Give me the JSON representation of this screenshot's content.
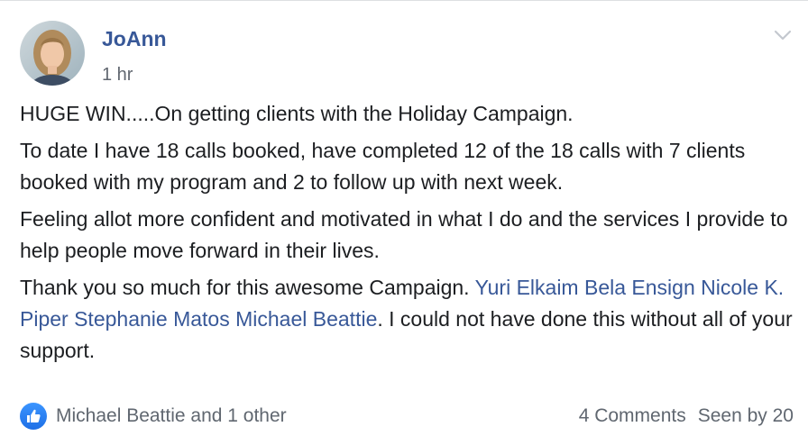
{
  "post": {
    "author": "JoAnn",
    "timestamp": "1 hr",
    "paragraphs": {
      "p1": "HUGE WIN.....On getting clients with the Holiday Campaign.",
      "p2": "To date I have 18 calls booked, have completed 12 of the 18 calls with 7 clients booked with my program and 2 to follow up with next week.",
      "p3": "Feeling allot more confident and motivated in what I do and the services I provide to help people move forward in their lives.",
      "p4_intro": "Thank you so much for this awesome Campaign.",
      "mentions": [
        "Yuri Elkaim",
        "Bela Ensign",
        "Nicole K. Piper",
        "Stephanie Matos",
        "Michael Beattie"
      ],
      "p4_outro": ". I could not have done this without all of your support."
    }
  },
  "footer": {
    "reactions_text": "Michael Beattie and 1 other",
    "comments": "4 Comments",
    "seen": "Seen by 20"
  },
  "colors": {
    "link": "#385898",
    "secondary_text": "#616770",
    "like_blue": "#2d88ff"
  },
  "icons": {
    "menu": "chevron-down-icon",
    "reaction": "like-icon"
  }
}
